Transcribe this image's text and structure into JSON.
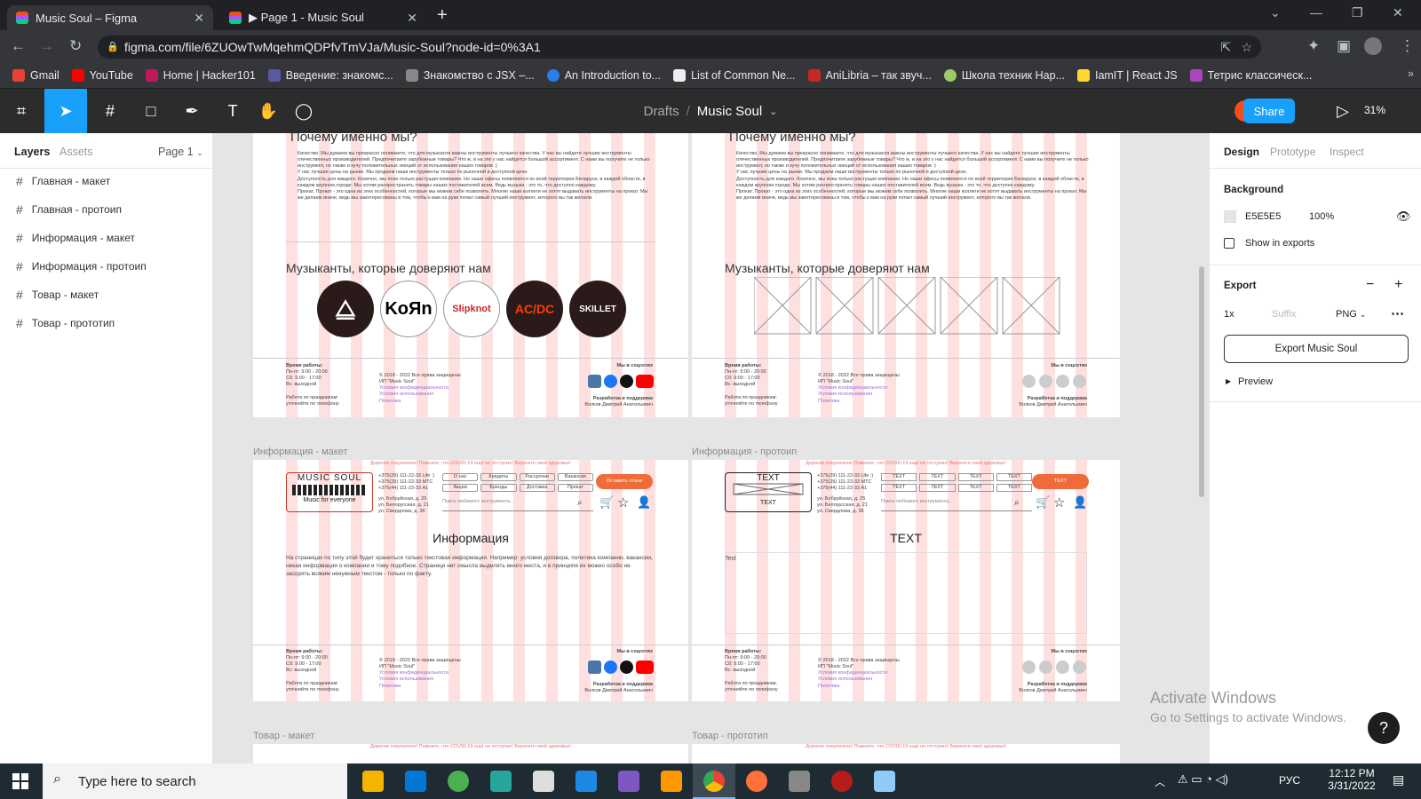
{
  "browser": {
    "tabs": [
      {
        "title": "Music Soul – Figma"
      },
      {
        "title": "▶ Page 1 - Music Soul"
      }
    ],
    "url": "figma.com/file/6ZUOwTwMqehmQDPfvTmVJa/Music-Soul?node-id=0%3A1",
    "bookmarks": [
      "Gmail",
      "YouTube",
      "Home | Hacker101",
      "Введение: знакомс...",
      "Знакомство с JSX –...",
      "An Introduction to...",
      "List of Common Ne...",
      "AniLibria – так звуч...",
      "Школа техник Нар...",
      "IamIT | React JS",
      "Тетрис классическ..."
    ]
  },
  "figma": {
    "breadcrumb_root": "Drafts",
    "breadcrumb_sep": "/",
    "file_name": "Music Soul",
    "share_label": "Share",
    "zoom": "31%",
    "left_tabs": {
      "layers": "Layers",
      "assets": "Assets",
      "page": "Page 1"
    },
    "layers": [
      "Главная - макет",
      "Главная - протоип",
      "Информация - макет",
      "Информация - протоип",
      "Товар - макет",
      "Товар - прототип"
    ],
    "right": {
      "tabs": [
        "Design",
        "Prototype",
        "Inspect"
      ],
      "background_label": "Background",
      "background_hex": "E5E5E5",
      "background_opacity": "100%",
      "show_in_exports": "Show in exports",
      "export_label": "Export",
      "export_scale": "1x",
      "export_suffix_placeholder": "Suffix",
      "export_format": "PNG",
      "export_button": "Export Music Soul",
      "preview_label": "Preview"
    }
  },
  "canvas": {
    "why_title": "Почему именно мы?",
    "why_items": [
      "Качество. Мы думаем вы прекрасно понимаете, что для музыканта важны инструменты лучшего качества. У нас вы найдете лучшие инструменты отечественных производителей. Предпочитаете зарубежные товары? Что ж, и на это у нас найдется большой ассортимент. С нами вы получите не только инструмент, но также и кучу положительных эмоций от использования наших товаров :)",
      "У нас лучшие цены на рынке. Мы продаем наши инструменты только по рыночной и доступной цене.",
      "Доступность для каждого. Конечно, мы пока только растущая компания. Но наши офисы появляются по всей территории Беларуси, в каждой области, в каждом крупном городе. Мы хотим распространять товары наших поставителей всем. Ведь музыка - это то, что доступно каждому.",
      "Прокат. Прокат - это одна из этих особенностей, которые мы можем себе позволить. Многие наши коллеги не хотят выдавать инструменты на прокат. Мы же делаем иначе, ведь мы заинтересованы в том, чтобы к вам на руки попал самый лучший инструмент, которого вы так желали."
    ],
    "musicians_title": "Музыканты, которые доверяют нам",
    "bands": [
      "linkin-park",
      "KoЯn",
      "Slipknot",
      "AC/DC",
      "SKILLET"
    ],
    "footer": {
      "hours_title": "Время работы:",
      "hours": "Пн-пт: 9:00 - 20:00\nСб: 9:00 - 17:00\nВс: выходной",
      "holidays": "Работа по праздникам:\nуточняйте по телефону",
      "copyright": "© 2018 - 2022 Все права защищены\nИП \"Music Soul\"",
      "links": "Условия конфиденциальности\nУсловия использования\nПолитика",
      "social_title": "Мы в соцсетях",
      "dev_title": "Разработка и поддержка",
      "dev_name": "Волков Дмитрий Анатольевич"
    },
    "frame_labels": [
      "Информация - макет",
      "Информация - протоип",
      "Товар - макет",
      "Товар - прототип"
    ],
    "covid_banner": "Дорогие покупатели! Помните, что COVID-19 ещё не отступил! Берегите своё здоровье!",
    "logo_title": "MUSIC SOUL",
    "logo_sub": "Music for everyone",
    "phones": "+375(29) 111-22-33 Life :)\n+375(29) 111-22-33 МТС\n+375(44) 111-22-33 A1",
    "addresses": "ул. Бобруйская, д. 25\nул. Белорусская, д. 21\nул. Свердлова, д. 36",
    "nav": [
      "О нас",
      "Кредиты",
      "Рассрочки",
      "Вакансии",
      "Акции",
      "Бренды",
      "Доставка",
      "Прокат"
    ],
    "feedback_btn": "Оставить отзыв",
    "search_placeholder": "Поиск любимого инструмента...",
    "info_title": "Информация",
    "info_text": "На страницах по типу этой будет храниться только текстовая информация. Например: условия договора, политика компании, вакансии, некая информация о компании и тому подобное. Странице нет смысла выделять много места, и в принципе их можно особо не засорять всяким ненужным текстом - только по факту.",
    "proto_text": "TEXT",
    "proto_small": "Text"
  },
  "windows": {
    "search_placeholder": "Type here to search",
    "lang": "РУС",
    "time": "12:12 PM",
    "date": "3/31/2022",
    "activate_title": "Activate Windows",
    "activate_sub": "Go to Settings to activate Windows.",
    "help": "?"
  }
}
